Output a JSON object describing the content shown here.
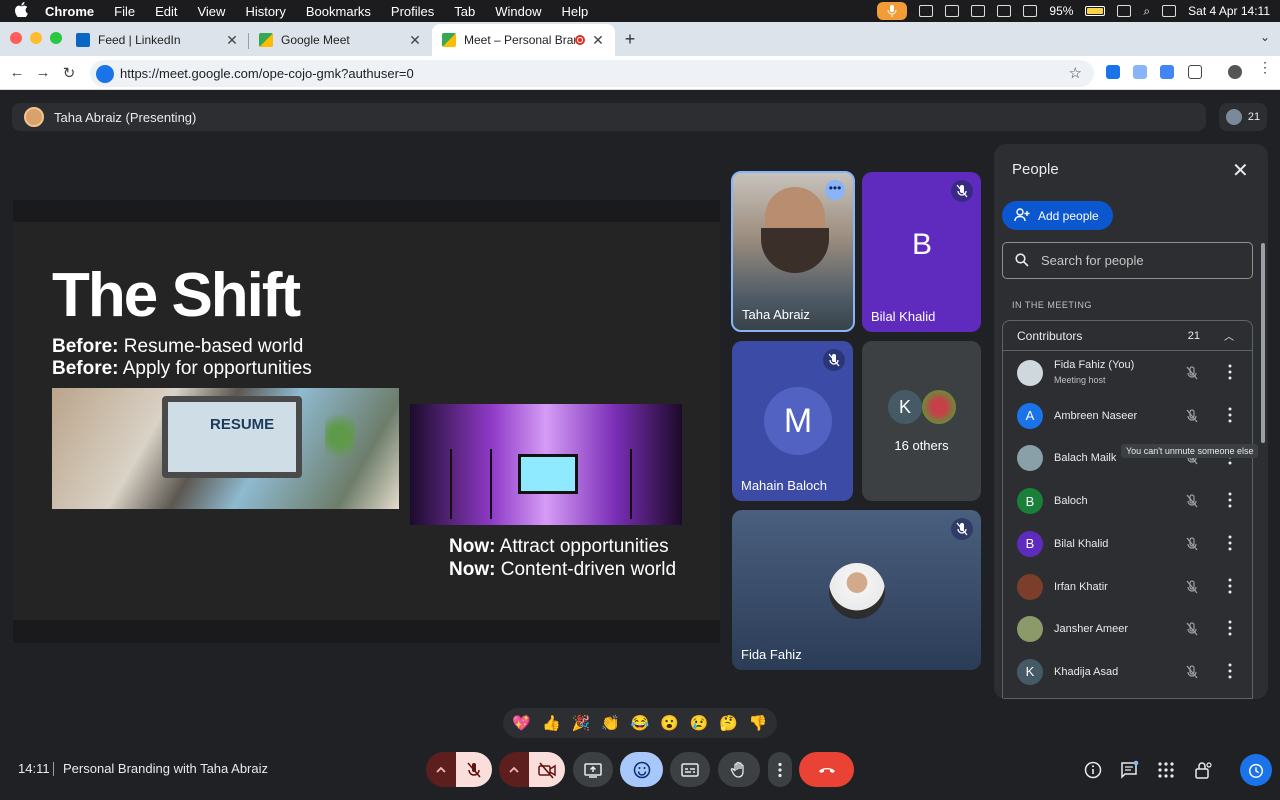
{
  "menubar": {
    "apple": "",
    "items": [
      "Chrome",
      "File",
      "Edit",
      "View",
      "History",
      "Bookmarks",
      "Profiles",
      "Tab",
      "Window",
      "Help"
    ],
    "battery": "95%",
    "datetime": "Sat 4 Apr  14:11"
  },
  "tabs": [
    {
      "title": "Feed | LinkedIn",
      "favicon_color": "#0a66c2"
    },
    {
      "title": "Google Meet",
      "favicon_color": "#34a853"
    },
    {
      "title": "Meet – Personal Branding",
      "favicon_color": "#34a853",
      "recording": true
    }
  ],
  "address": {
    "url": "https://meet.google.com/ope-cojo-gmk?authuser=0"
  },
  "presenter": {
    "label": "Taha Abraiz (Presenting)",
    "count": "21"
  },
  "slide": {
    "title": "The Shift",
    "line1_bold": "Before:",
    "line1": " Resume-based world",
    "line2_bold": "Before:",
    "line2": " Apply for opportunities",
    "resume_text": "RESUME",
    "line3_bold": "Now:",
    "line3": " Attract opportunities",
    "line4_bold": "Now:",
    "line4": " Content-driven world"
  },
  "tiles": {
    "taha": {
      "name": "Taha Abraiz"
    },
    "bilal": {
      "name": "Bilal Khalid",
      "letter": "B",
      "color": "#5f2bbf"
    },
    "mahain": {
      "name": "Mahain Baloch",
      "letter": "M",
      "color": "#3c4ba6"
    },
    "others": {
      "label": "16 others",
      "letter": "K"
    },
    "fida": {
      "name": "Fida Fahiz"
    }
  },
  "people": {
    "title": "People",
    "add_label": "Add people",
    "search_placeholder": "Search for people",
    "section": "IN THE MEETING",
    "group": "Contributors",
    "group_count": "21",
    "tooltip": "You can't unmute someone else",
    "rows": [
      {
        "name": "Fida Fahiz (You)",
        "sub": "Meeting host",
        "letter": "",
        "color": "#cfd8dc"
      },
      {
        "name": "Ambreen Naseer",
        "sub": "",
        "letter": "A",
        "color": "#1a73e8"
      },
      {
        "name": "Balach Mailk",
        "sub": "",
        "letter": "",
        "color": "#8aa0a8"
      },
      {
        "name": "Baloch",
        "sub": "",
        "letter": "B",
        "color": "#188038"
      },
      {
        "name": "Bilal Khalid",
        "sub": "",
        "letter": "B",
        "color": "#5f2bbf"
      },
      {
        "name": "Irfan Khatir",
        "sub": "",
        "letter": "",
        "color": "#7a3e2a"
      },
      {
        "name": "Jansher Ameer",
        "sub": "",
        "letter": "",
        "color": "#8c9a6a"
      },
      {
        "name": "Khadija Asad",
        "sub": "",
        "letter": "K",
        "color": "#455a64"
      }
    ]
  },
  "reactions": [
    "💖",
    "👍",
    "🎉",
    "👏",
    "😂",
    "😮",
    "😢",
    "🤔",
    "👎"
  ],
  "bottom": {
    "time": "14:11",
    "meeting": "Personal Branding with Taha Abraiz"
  },
  "colors": {
    "accent": "#0b57d0",
    "danger": "#ea4335",
    "muted_btn": "#f9dedc"
  }
}
